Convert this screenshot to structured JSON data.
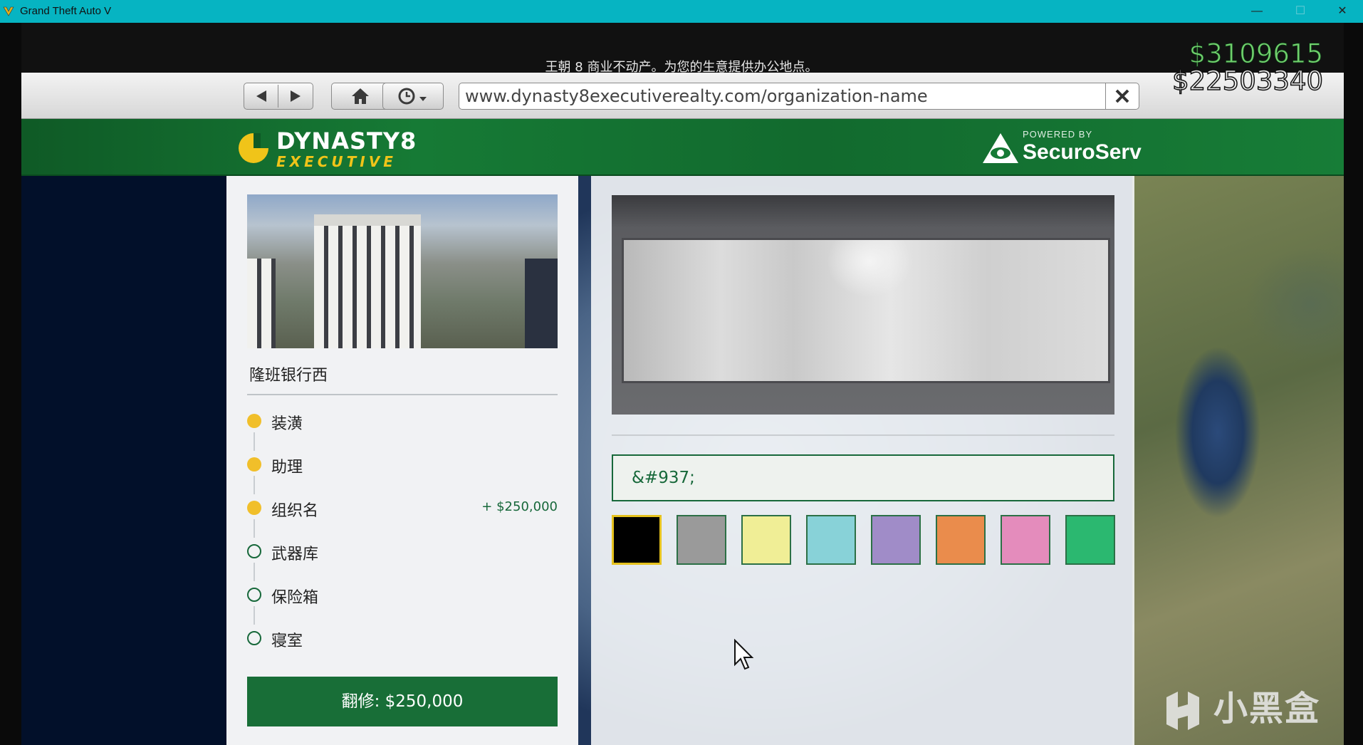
{
  "window": {
    "title": "Grand Theft Auto V",
    "min_glyph": "—",
    "max_glyph": "☐",
    "close_glyph": "✕"
  },
  "hud": {
    "subtitle": "王朝 8 商业不动产。为您的生意提供办公地点。",
    "cash": "$3109615",
    "bank": "$22503340"
  },
  "browser": {
    "url": "www.dynasty8executiverealty.com/organization-name",
    "icons": [
      "back-arrow-icon",
      "forward-arrow-icon",
      "home-icon",
      "history-clock-icon",
      "clear-x-icon"
    ]
  },
  "site": {
    "brand_top": "DYNASTY8",
    "brand_sub": "EXECUTIVE",
    "powered_by": "POWERED BY",
    "partner": "SecuroServ"
  },
  "left": {
    "property_name": "隆班银行西",
    "steps": [
      {
        "label": "装潢",
        "done": true,
        "price": ""
      },
      {
        "label": "助理",
        "done": true,
        "price": ""
      },
      {
        "label": "组织名",
        "done": true,
        "price": "+ $250,000"
      },
      {
        "label": "武器库",
        "done": false,
        "price": ""
      },
      {
        "label": "保险箱",
        "done": false,
        "price": ""
      },
      {
        "label": "寝室",
        "done": false,
        "price": ""
      }
    ],
    "renovate_button": "翻修: $250,000"
  },
  "right": {
    "org_name_value": "&#937;",
    "swatches": [
      {
        "color": "#000000",
        "selected": true
      },
      {
        "color": "#9a9a9a",
        "selected": false
      },
      {
        "color": "#f0ee96",
        "selected": false
      },
      {
        "color": "#88d2d8",
        "selected": false
      },
      {
        "color": "#a08cc8",
        "selected": false
      },
      {
        "color": "#ea8c4c",
        "selected": false
      },
      {
        "color": "#e48cbc",
        "selected": false
      },
      {
        "color": "#2bb870",
        "selected": false
      }
    ]
  },
  "watermark": "小黑盒",
  "colors": {
    "accent_green": "#186e37",
    "step_yellow": "#f1bf2a",
    "cash_green": "#6fd06c"
  }
}
